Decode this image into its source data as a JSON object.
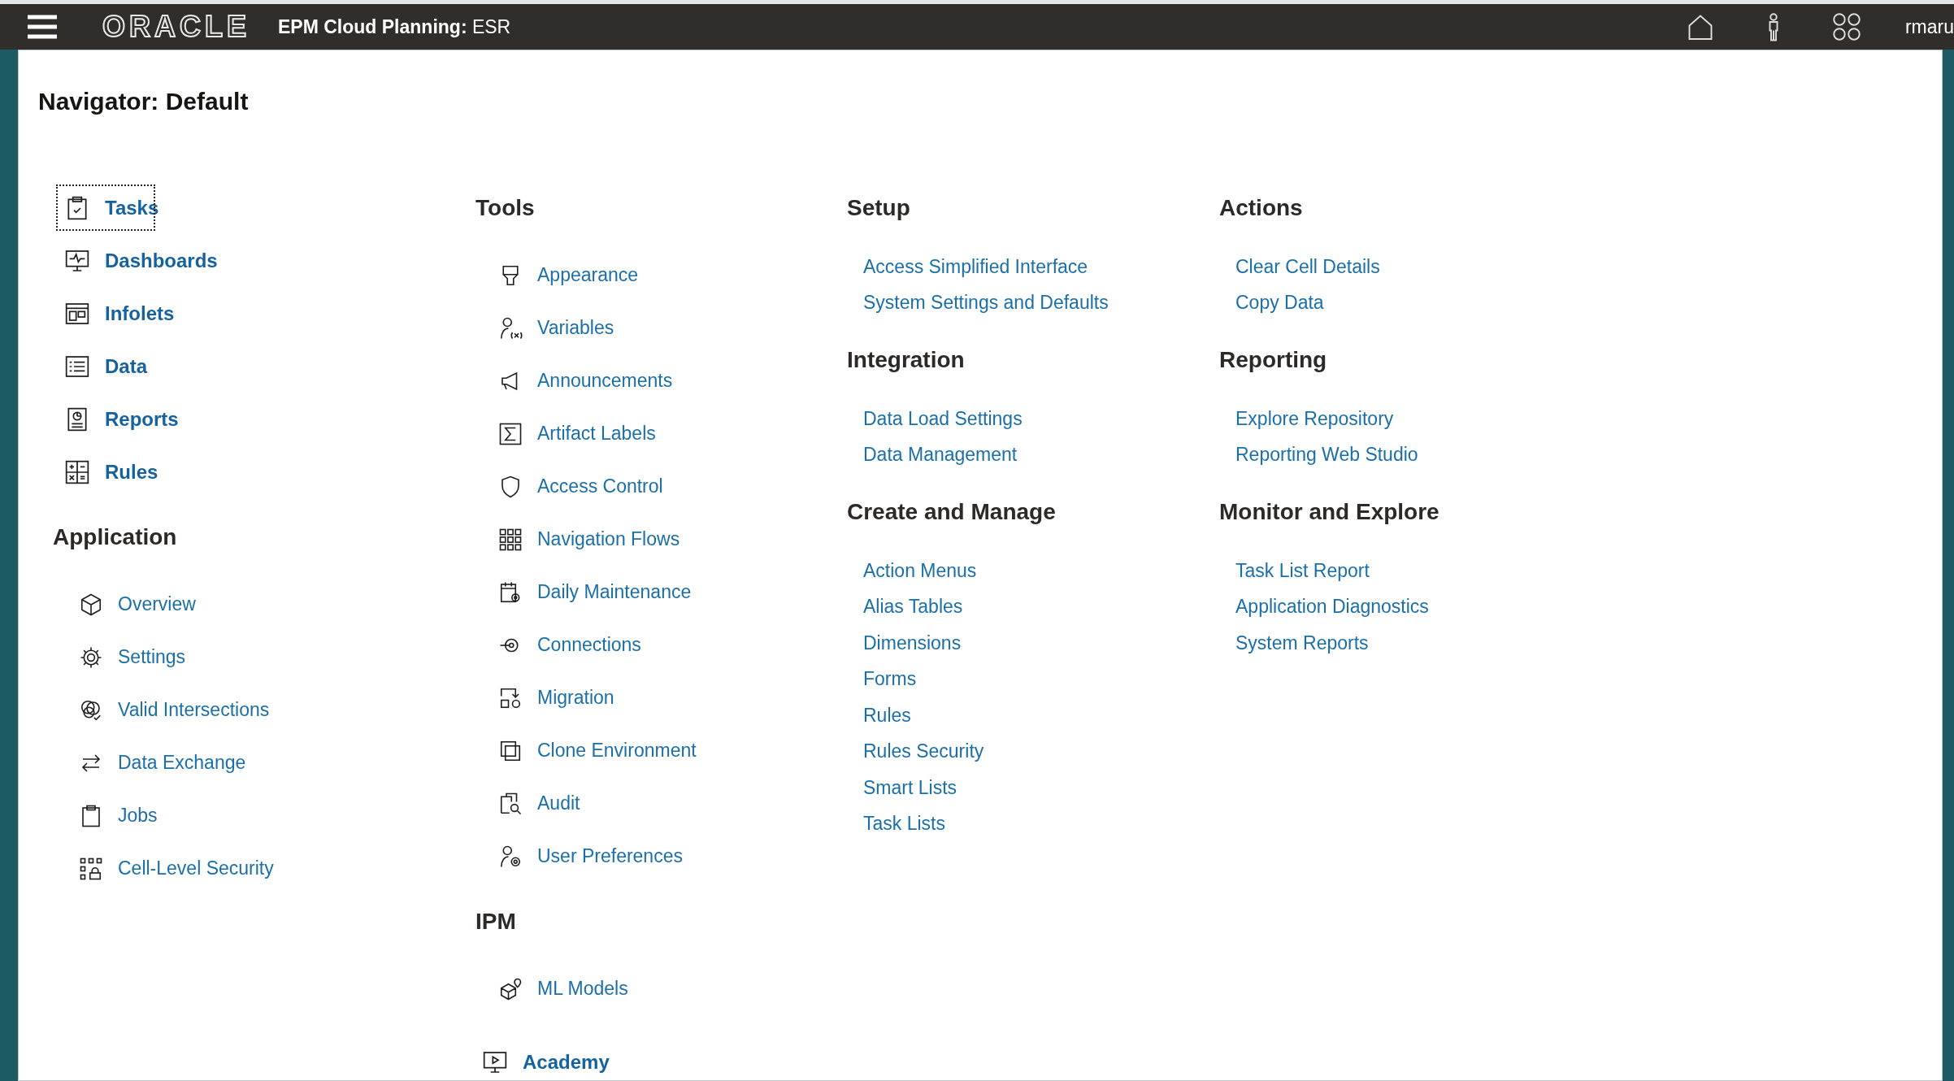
{
  "header": {
    "logo": "ORACLE",
    "product": "EPM Cloud Planning:",
    "app": "ESR",
    "user": "rmaru"
  },
  "navigator": {
    "title": "Navigator: Default"
  },
  "columns": [
    {
      "sections": [
        {
          "kind": "primary",
          "items": [
            {
              "label": "Tasks",
              "focused": true
            },
            {
              "label": "Dashboards",
              "focused": false
            },
            {
              "label": "Infolets",
              "focused": false
            },
            {
              "label": "Data",
              "focused": false
            },
            {
              "label": "Reports",
              "focused": false
            },
            {
              "label": "Rules",
              "focused": false
            }
          ]
        },
        {
          "kind": "tool",
          "heading": "Application",
          "items": [
            {
              "label": "Overview",
              "focused": false
            },
            {
              "label": "Settings",
              "focused": false
            },
            {
              "label": "Valid Intersections",
              "focused": false
            },
            {
              "label": "Data Exchange",
              "focused": false
            },
            {
              "label": "Jobs",
              "focused": false
            },
            {
              "label": "Cell-Level Security",
              "focused": false
            }
          ]
        }
      ]
    },
    {
      "sections": [
        {
          "kind": "tool",
          "heading": "Tools",
          "items": [
            {
              "label": "Appearance",
              "focused": false
            },
            {
              "label": "Variables",
              "focused": false
            },
            {
              "label": "Announcements",
              "focused": false
            },
            {
              "label": "Artifact Labels",
              "focused": false
            },
            {
              "label": "Access Control",
              "focused": false
            },
            {
              "label": "Navigation Flows",
              "focused": false
            },
            {
              "label": "Daily Maintenance",
              "focused": false
            },
            {
              "label": "Connections",
              "focused": false
            },
            {
              "label": "Migration",
              "focused": false
            },
            {
              "label": "Clone Environment",
              "focused": false
            },
            {
              "label": "Audit",
              "focused": false
            },
            {
              "label": "User Preferences",
              "focused": false
            }
          ]
        },
        {
          "kind": "tool",
          "heading": "IPM",
          "items": [
            {
              "label": "ML Models",
              "focused": false
            }
          ]
        },
        {
          "kind": "primary",
          "items": [
            {
              "label": "Academy",
              "focused": false
            }
          ]
        }
      ]
    },
    {
      "sections": [
        {
          "kind": "link",
          "heading": "Setup",
          "items": [
            {
              "label": "Access Simplified Interface",
              "focused": false
            },
            {
              "label": "System Settings and Defaults",
              "focused": false
            }
          ]
        },
        {
          "kind": "link",
          "heading": "Integration",
          "items": [
            {
              "label": "Data Load Settings",
              "focused": false
            },
            {
              "label": "Data Management",
              "focused": false
            }
          ]
        },
        {
          "kind": "link",
          "heading": "Create and Manage",
          "items": [
            {
              "label": "Action Menus",
              "focused": false
            },
            {
              "label": "Alias Tables",
              "focused": false
            },
            {
              "label": "Dimensions",
              "focused": false
            },
            {
              "label": "Forms",
              "focused": false
            },
            {
              "label": "Rules",
              "focused": false
            },
            {
              "label": "Rules Security",
              "focused": false
            },
            {
              "label": "Smart Lists",
              "focused": false
            },
            {
              "label": "Task Lists",
              "focused": false
            }
          ]
        }
      ]
    },
    {
      "sections": [
        {
          "kind": "link",
          "heading": "Actions",
          "items": [
            {
              "label": "Clear Cell Details",
              "focused": false
            },
            {
              "label": "Copy Data",
              "focused": false
            }
          ]
        },
        {
          "kind": "link",
          "heading": "Reporting",
          "items": [
            {
              "label": "Explore Repository",
              "focused": false
            },
            {
              "label": "Reporting Web Studio",
              "focused": false
            }
          ]
        },
        {
          "kind": "link",
          "heading": "Monitor and Explore",
          "items": [
            {
              "label": "Task List Report",
              "focused": false
            },
            {
              "label": "Application Diagnostics",
              "focused": false
            },
            {
              "label": "System Reports",
              "focused": false
            }
          ]
        }
      ]
    }
  ]
}
